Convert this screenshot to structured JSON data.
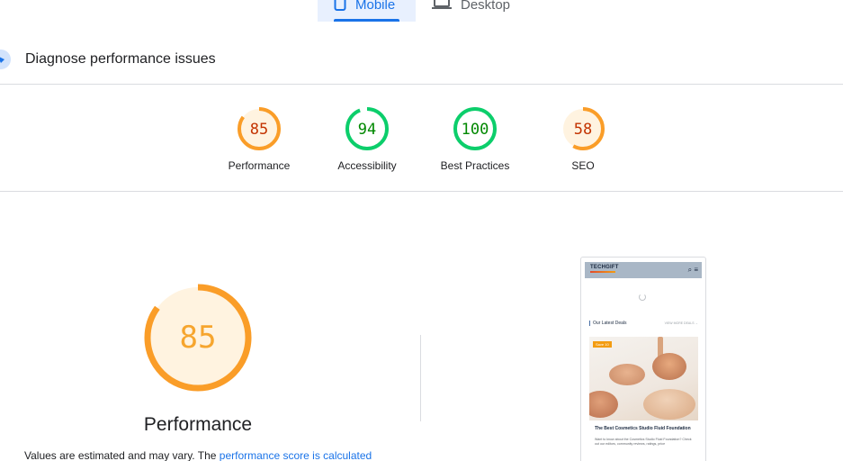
{
  "device_tabs": [
    {
      "label": "Mobile",
      "active": true,
      "icon": "phone-icon"
    },
    {
      "label": "Desktop",
      "active": false,
      "icon": "laptop-icon"
    }
  ],
  "diagnose": {
    "title": "Diagnose performance issues",
    "icon": "gauge-icon"
  },
  "categories": [
    {
      "label": "Performance",
      "score": "85",
      "value": 0.85,
      "color": "#fa9d28",
      "fill": "#fff3e0",
      "text_color": "#c33300"
    },
    {
      "label": "Accessibility",
      "score": "94",
      "value": 0.94,
      "color": "#0cce6b",
      "fill": "#ffffff",
      "text_color": "#008800"
    },
    {
      "label": "Best Practices",
      "score": "100",
      "value": 1.0,
      "color": "#0cce6b",
      "fill": "#ffffff",
      "text_color": "#008800"
    },
    {
      "label": "SEO",
      "score": "58",
      "value": 0.58,
      "color": "#fa9d28",
      "fill": "#fff3e0",
      "text_color": "#c33300"
    }
  ],
  "main_gauge": {
    "title": "Performance",
    "score": "85",
    "value": 0.85,
    "color": "#fa9d28",
    "fill": "#fff3e0",
    "text_color": "#f6a52e"
  },
  "note": {
    "prefix": "Values are estimated and may vary. The ",
    "link": "performance score is calculated"
  },
  "screenshot": {
    "logo": "TECHGIFT",
    "section": "Our Latest Deals",
    "view_all": "VIEW MORE DEALS →",
    "tag": "Save 10",
    "headline": "The Best Cosmetics Studio Fluid Foundation",
    "desc": "Want to know about the Cosmetics Studio Fluid Foundation? Check out our editors, community reviews, ratings, price"
  }
}
